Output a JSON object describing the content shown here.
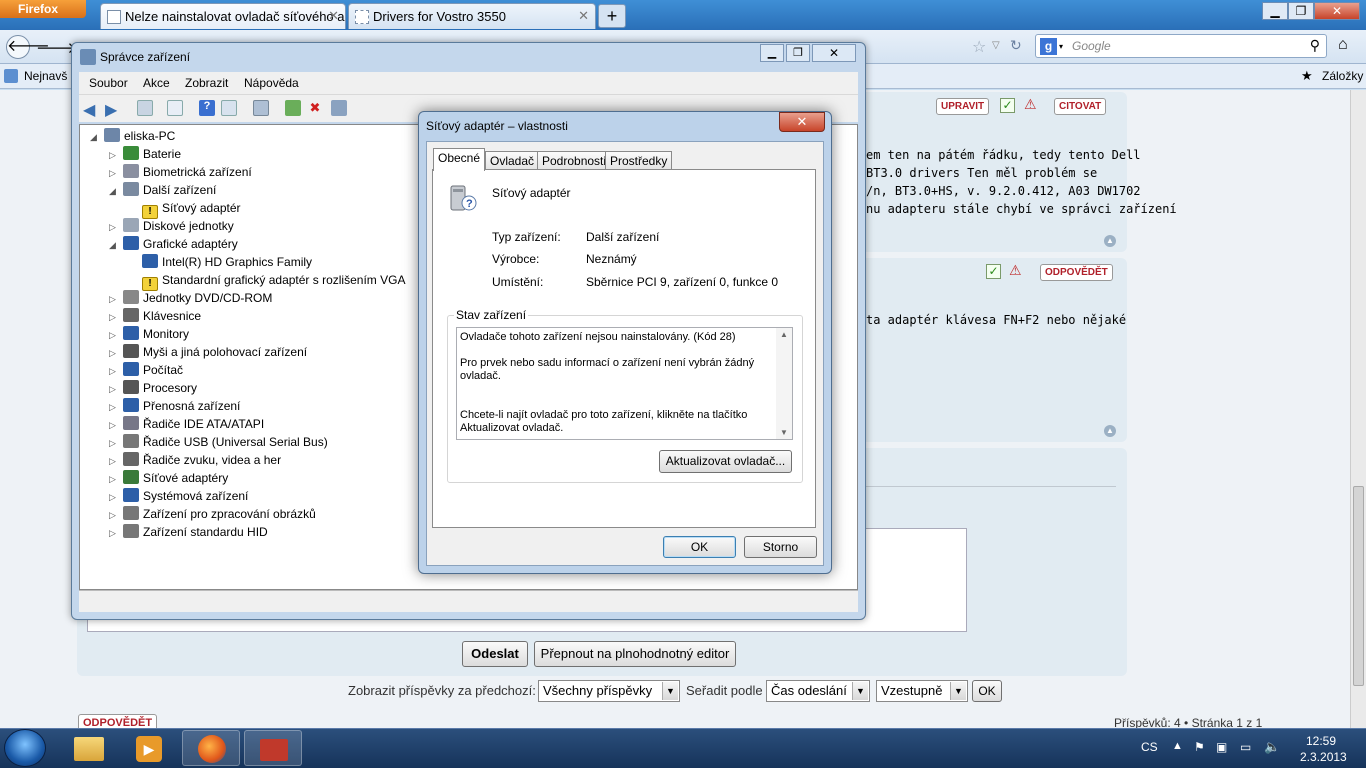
{
  "browser": {
    "menu_label": "Firefox",
    "tabs": [
      {
        "label": "Nelze nainstalovat ovladač síťového a..."
      },
      {
        "label": "Drivers for Vostro 3550"
      }
    ],
    "new_tab": "+",
    "search_placeholder": "Google",
    "bookmark_left": "Nejnavš",
    "bookmarks_label": "Záložky"
  },
  "page": {
    "post1_buttons": {
      "edit": "UPRAVIT",
      "quote": "CITOVAT"
    },
    "post1_lines": [
      "em ten na pátém řádku, tedy tento Dell",
      "BT3.0 drivers Ten měl problém se",
      "/n, BT3.0+HS, v. 9.2.0.412, A03 DW1702",
      "nu adapteru stále chybí ve správci zařízení"
    ],
    "post2_button": "ODPOVĚDĚT",
    "post2_line": "ta adaptér klávesa FN+F2 nebo nějaké",
    "send_button": "Odeslat",
    "full_editor_button": "Přepnout na plnohodnotný editor",
    "filter": {
      "show_label": "Zobrazit příspěvky za předchozí:",
      "show_value": "Všechny příspěvky",
      "sort_label": "Seřadit podle",
      "sort_value": "Čas odeslání",
      "order_value": "Vzestupně",
      "ok": "OK"
    },
    "reply_button": "ODPOVĚDĚT",
    "pagination": "Příspěvků: 4 • Stránka 1 z 1"
  },
  "device_manager": {
    "title": "Správce zařízení",
    "menu": [
      "Soubor",
      "Akce",
      "Zobrazit",
      "Nápověda"
    ],
    "tree": [
      {
        "label": "eliska-PC",
        "level": 0,
        "expander": "◢"
      },
      {
        "label": "Baterie",
        "level": 1,
        "expander": "▷"
      },
      {
        "label": "Biometrická zařízení",
        "level": 1,
        "expander": "▷"
      },
      {
        "label": "Další zařízení",
        "level": 1,
        "expander": "◢"
      },
      {
        "label": "Síťový adaptér",
        "level": 2,
        "expander": "",
        "warning": true
      },
      {
        "label": "Diskové jednotky",
        "level": 1,
        "expander": "▷"
      },
      {
        "label": "Grafické adaptéry",
        "level": 1,
        "expander": "◢"
      },
      {
        "label": "Intel(R) HD Graphics Family",
        "level": 2,
        "expander": ""
      },
      {
        "label": "Standardní grafický adaptér s rozlišením VGA",
        "level": 2,
        "expander": "",
        "warning": true
      },
      {
        "label": "Jednotky DVD/CD-ROM",
        "level": 1,
        "expander": "▷"
      },
      {
        "label": "Klávesnice",
        "level": 1,
        "expander": "▷"
      },
      {
        "label": "Monitory",
        "level": 1,
        "expander": "▷"
      },
      {
        "label": "Myši a jiná polohovací zařízení",
        "level": 1,
        "expander": "▷"
      },
      {
        "label": "Počítač",
        "level": 1,
        "expander": "▷"
      },
      {
        "label": "Procesory",
        "level": 1,
        "expander": "▷"
      },
      {
        "label": "Přenosná zařízení",
        "level": 1,
        "expander": "▷"
      },
      {
        "label": "Řadiče IDE ATA/ATAPI",
        "level": 1,
        "expander": "▷"
      },
      {
        "label": "Řadiče USB (Universal Serial Bus)",
        "level": 1,
        "expander": "▷"
      },
      {
        "label": "Řadiče zvuku, videa a her",
        "level": 1,
        "expander": "▷"
      },
      {
        "label": "Síťové adaptéry",
        "level": 1,
        "expander": "▷"
      },
      {
        "label": "Systémová zařízení",
        "level": 1,
        "expander": "▷"
      },
      {
        "label": "Zařízení pro zpracování obrázků",
        "level": 1,
        "expander": "▷"
      },
      {
        "label": "Zařízení standardu HID",
        "level": 1,
        "expander": "▷"
      }
    ]
  },
  "properties": {
    "title": "Síťový adaptér – vlastnosti",
    "tabs": [
      "Obecné",
      "Ovladač",
      "Podrobnosti",
      "Prostředky"
    ],
    "device_name": "Síťový adaptér",
    "fields": [
      {
        "label": "Typ zařízení:",
        "value": "Další zařízení"
      },
      {
        "label": "Výrobce:",
        "value": "Neznámý"
      },
      {
        "label": "Umístění:",
        "value": "Sběrnice PCI 9, zařízení 0, funkce 0"
      }
    ],
    "status_group": "Stav zařízení",
    "status_lines": [
      "Ovladače tohoto zařízení nejsou nainstalovány. (Kód 28)",
      "Pro prvek nebo sadu informací o zařízení není vybrán žádný ovladač.",
      "Chcete-li najít ovladač pro toto zařízení, klikněte na tlačítko Aktualizovat ovladač."
    ],
    "update_button": "Aktualizovat ovladač...",
    "ok": "OK",
    "cancel": "Storno"
  },
  "taskbar": {
    "lang": "CS",
    "time": "12:59",
    "date": "2.3.2013"
  }
}
